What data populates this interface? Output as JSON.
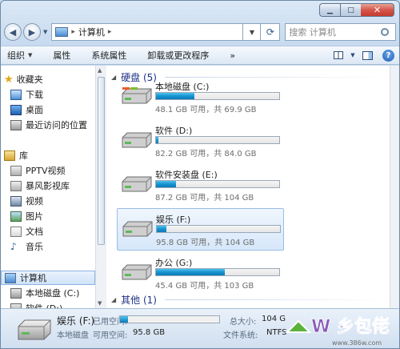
{
  "window": {
    "minimize_glyph": "▁",
    "maximize_glyph": "□",
    "close_glyph": "✕"
  },
  "address": {
    "breadcrumb": "计算机",
    "search_placeholder": "搜索 计算机"
  },
  "toolbar": {
    "organize": "组织",
    "properties": "属性",
    "system_properties": "系统属性",
    "uninstall": "卸载或更改程序",
    "more": "»"
  },
  "nav": {
    "favorites": "收藏夹",
    "downloads": "下载",
    "desktop": "桌面",
    "recent": "最近访问的位置",
    "libraries": "库",
    "pptv": "PPTV视频",
    "baofeng": "暴风影视库",
    "videos": "视频",
    "pictures": "图片",
    "documents": "文档",
    "music": "音乐",
    "computer": "计算机",
    "local_c": "本地磁盘 (C:)",
    "software_d": "软件 (D:)"
  },
  "groups": {
    "hdd": "硬盘 (5)",
    "other": "其他 (1)"
  },
  "drives": [
    {
      "name": "本地磁盘 (C:)",
      "size": "48.1 GB 可用，共 69.9 GB",
      "used_fraction": 0.31
    },
    {
      "name": "软件 (D:)",
      "size": "82.2 GB 可用，共 84.0 GB",
      "used_fraction": 0.02
    },
    {
      "name": "软件安装盘 (E:)",
      "size": "87.2 GB 可用，共 104 GB",
      "used_fraction": 0.16
    },
    {
      "name": "娱乐 (F:)",
      "size": "95.8 GB 可用，共 104 GB",
      "used_fraction": 0.08
    },
    {
      "name": "办公 (G:)",
      "size": "45.4 GB 可用，共 103 GB",
      "used_fraction": 0.56
    }
  ],
  "details": {
    "name": "娱乐 (F:)",
    "type": "本地磁盘",
    "used_label": "已用空间:",
    "free_label": "可用空间:",
    "free_value": "95.8 GB",
    "total_label": "总大小:",
    "total_value": "104 G",
    "fs_label": "文件系统:",
    "fs_value": "NTFS",
    "used_fraction": 0.08
  },
  "watermark": {
    "brand": "W 乡包佬",
    "url": "www.386w.com"
  },
  "colors": {
    "accent": "#1793cf",
    "group_header": "#1e3287"
  }
}
